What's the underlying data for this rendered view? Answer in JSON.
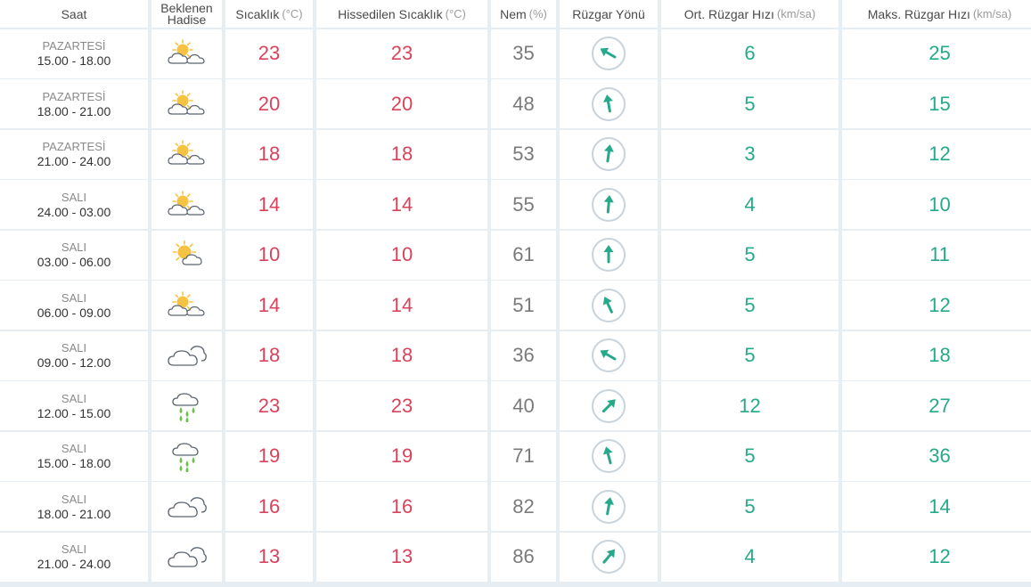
{
  "header": {
    "saat": "Saat",
    "hadise": [
      "Beklenen",
      "Hadise"
    ],
    "sicaklik": "Sıcaklık",
    "sicaklik_unit": "(°C)",
    "hissedilen": "Hissedilen Sıcaklık",
    "hissedilen_unit": "(°C)",
    "nem": "Nem",
    "nem_unit": "(%)",
    "yon": "Rüzgar Yönü",
    "ort": "Ort. Rüzgar Hızı",
    "ort_unit": "(km/sa)",
    "maks": "Maks. Rüzgar Hızı",
    "maks_unit": "(km/sa)"
  },
  "colors": {
    "temperature": "#d9435a",
    "wind": "#26a98a",
    "sun": "#f5c242",
    "rain": "#6dc24a"
  },
  "rows": [
    {
      "day": "PAZARTESİ",
      "time": "15.00 - 18.00",
      "icon": "partly-cloudy-icon",
      "temp": "23",
      "feels": "23",
      "humidity": "35",
      "wind_dir_deg": 300,
      "wind_avg": "6",
      "wind_max": "25"
    },
    {
      "day": "PAZARTESİ",
      "time": "18.00 - 21.00",
      "icon": "partly-cloudy-icon",
      "temp": "20",
      "feels": "20",
      "humidity": "48",
      "wind_dir_deg": 350,
      "wind_avg": "5",
      "wind_max": "15"
    },
    {
      "day": "PAZARTESİ",
      "time": "21.00 - 24.00",
      "icon": "partly-cloudy-icon",
      "temp": "18",
      "feels": "18",
      "humidity": "53",
      "wind_dir_deg": 8,
      "wind_avg": "3",
      "wind_max": "12"
    },
    {
      "day": "SALI",
      "time": "24.00 - 03.00",
      "icon": "partly-cloudy-icon",
      "temp": "14",
      "feels": "14",
      "humidity": "55",
      "wind_dir_deg": 5,
      "wind_avg": "4",
      "wind_max": "10"
    },
    {
      "day": "SALI",
      "time": "03.00 - 06.00",
      "icon": "mostly-sunny-icon",
      "temp": "10",
      "feels": "10",
      "humidity": "61",
      "wind_dir_deg": 0,
      "wind_avg": "5",
      "wind_max": "11"
    },
    {
      "day": "SALI",
      "time": "06.00 - 09.00",
      "icon": "partly-cloudy-icon",
      "temp": "14",
      "feels": "14",
      "humidity": "51",
      "wind_dir_deg": 335,
      "wind_avg": "5",
      "wind_max": "12"
    },
    {
      "day": "SALI",
      "time": "09.00 - 12.00",
      "icon": "cloudy-icon",
      "temp": "18",
      "feels": "18",
      "humidity": "36",
      "wind_dir_deg": 300,
      "wind_avg": "5",
      "wind_max": "18"
    },
    {
      "day": "SALI",
      "time": "12.00 - 15.00",
      "icon": "rain-icon",
      "temp": "23",
      "feels": "23",
      "humidity": "40",
      "wind_dir_deg": 45,
      "wind_avg": "12",
      "wind_max": "27"
    },
    {
      "day": "SALI",
      "time": "15.00 - 18.00",
      "icon": "rain-icon",
      "temp": "19",
      "feels": "19",
      "humidity": "71",
      "wind_dir_deg": 345,
      "wind_avg": "5",
      "wind_max": "36"
    },
    {
      "day": "SALI",
      "time": "18.00 - 21.00",
      "icon": "cloudy-icon",
      "temp": "16",
      "feels": "16",
      "humidity": "82",
      "wind_dir_deg": 10,
      "wind_avg": "5",
      "wind_max": "14"
    },
    {
      "day": "SALI",
      "time": "21.00 - 24.00",
      "icon": "cloudy-icon",
      "temp": "13",
      "feels": "13",
      "humidity": "86",
      "wind_dir_deg": 40,
      "wind_avg": "4",
      "wind_max": "12"
    }
  ]
}
